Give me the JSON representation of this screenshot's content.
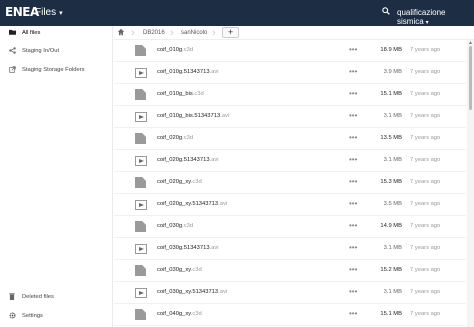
{
  "header": {
    "logo": "ENEA",
    "app_title": "Files",
    "caret": "▾",
    "search_icon": "search-icon",
    "user": "qualificazione sismica"
  },
  "sidebar": {
    "items": [
      {
        "label": "All files",
        "icon": "folder-icon"
      },
      {
        "label": "Staging In/Out",
        "icon": "share-icon"
      },
      {
        "label": "Staging Storage Folders",
        "icon": "external-icon"
      }
    ],
    "footer": [
      {
        "label": "Deleted files",
        "icon": "trash-icon"
      },
      {
        "label": "Settings",
        "icon": "gear-icon"
      }
    ]
  },
  "breadcrumb": {
    "home_icon": "home-icon",
    "items": [
      "DB2016",
      "sanNicolo"
    ],
    "add": "+"
  },
  "files": [
    {
      "base": "coif_010g",
      "ext": ".c3d",
      "type": "file",
      "size": "18.9 MB",
      "small": false,
      "mtime": "7 years ago"
    },
    {
      "base": "coif_010g.51343713",
      "ext": ".avi",
      "type": "video",
      "size": "3.9 MB",
      "small": true,
      "mtime": "7 years ago"
    },
    {
      "base": "coif_010g_bis",
      "ext": ".c3d",
      "type": "file",
      "size": "15.1 MB",
      "small": false,
      "mtime": "7 years ago"
    },
    {
      "base": "coif_010g_bis.51343713",
      "ext": ".avi",
      "type": "video",
      "size": "3.1 MB",
      "small": true,
      "mtime": "7 years ago"
    },
    {
      "base": "coif_020g",
      "ext": ".c3d",
      "type": "file",
      "size": "13.5 MB",
      "small": false,
      "mtime": "7 years ago"
    },
    {
      "base": "coif_020g.51343713",
      "ext": ".avi",
      "type": "video",
      "size": "3.1 MB",
      "small": true,
      "mtime": "7 years ago"
    },
    {
      "base": "coif_020g_xy",
      "ext": ".c3d",
      "type": "file",
      "size": "15.3 MB",
      "small": false,
      "mtime": "7 years ago"
    },
    {
      "base": "coif_020g_xy.51343713",
      "ext": ".avi",
      "type": "video",
      "size": "3.5 MB",
      "small": true,
      "mtime": "7 years ago"
    },
    {
      "base": "coif_030g",
      "ext": ".c3d",
      "type": "file",
      "size": "14.9 MB",
      "small": false,
      "mtime": "7 years ago"
    },
    {
      "base": "coif_030g.51343713",
      "ext": ".avi",
      "type": "video",
      "size": "3.1 MB",
      "small": true,
      "mtime": "7 years ago"
    },
    {
      "base": "coif_030g_xy",
      "ext": ".c3d",
      "type": "file",
      "size": "15.2 MB",
      "small": false,
      "mtime": "7 years ago"
    },
    {
      "base": "coif_030g_xy.51343713",
      "ext": ".avi",
      "type": "video",
      "size": "3.1 MB",
      "small": true,
      "mtime": "7 years ago"
    },
    {
      "base": "coif_040g_xy",
      "ext": ".c3d",
      "type": "file",
      "size": "15.1 MB",
      "small": false,
      "mtime": "7 years ago"
    }
  ],
  "more_label": "•••",
  "colors": {
    "header_bg": "#1d2d44",
    "file_icon": "#9a9a9a"
  }
}
